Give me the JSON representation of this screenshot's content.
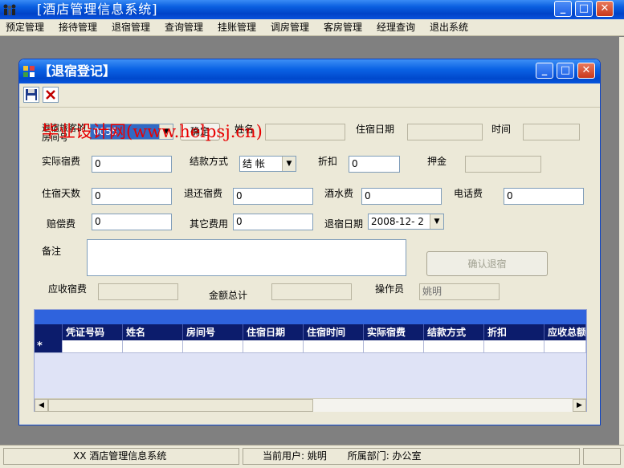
{
  "app": {
    "title": "[酒店管理信息系统]"
  },
  "menu": [
    "预定管理",
    "接待管理",
    "退宿管理",
    "查询管理",
    "挂账管理",
    "调房管理",
    "客房管理",
    "经理查询",
    "退出系统"
  ],
  "form": {
    "title": "【退宿登记】",
    "fields": {
      "room_label": "退宿旅客的房间号",
      "room_value": "0055",
      "confirm_label": "确定",
      "name_label": "姓名",
      "checkin_date_label": "住宿日期",
      "time_label": "时间",
      "actual_fee_label": "实际宿费",
      "actual_fee_value": "0",
      "payment_method_label": "结款方式",
      "payment_method_value": "结 帐",
      "discount_label": "折扣",
      "discount_value": "0",
      "deposit_label": "押金",
      "stay_days_label": "住宿天数",
      "stay_days_value": "0",
      "refund_fee_label": "退还宿费",
      "refund_fee_value": "0",
      "drinks_fee_label": "酒水费",
      "drinks_fee_value": "0",
      "phone_fee_label": "电话费",
      "phone_fee_value": "0",
      "compensation_label": "赔偿费",
      "compensation_value": "0",
      "other_fee_label": "其它费用",
      "other_fee_value": "0",
      "checkout_date_label": "退宿日期",
      "checkout_date_value": "2008-12- 2",
      "remarks_label": "备注",
      "confirm_checkout_label": "确认退宿",
      "receivable_label": "应收宿费",
      "total_label": "金额总计",
      "operator_label": "操作员",
      "operator_value": "姚明"
    },
    "grid": {
      "columns": [
        "凭证号码",
        "姓名",
        "房间号",
        "住宿日期",
        "住宿时间",
        "实际宿费",
        "结款方式",
        "折扣",
        "应收总额"
      ],
      "new_row_marker": "*"
    }
  },
  "watermark": "毕业设计网(www.helpsj.cn)",
  "status": {
    "system": "XX 酒店管理信息系统",
    "user": "当前用户: 姚明",
    "dept": "所属部门: 办公室"
  }
}
